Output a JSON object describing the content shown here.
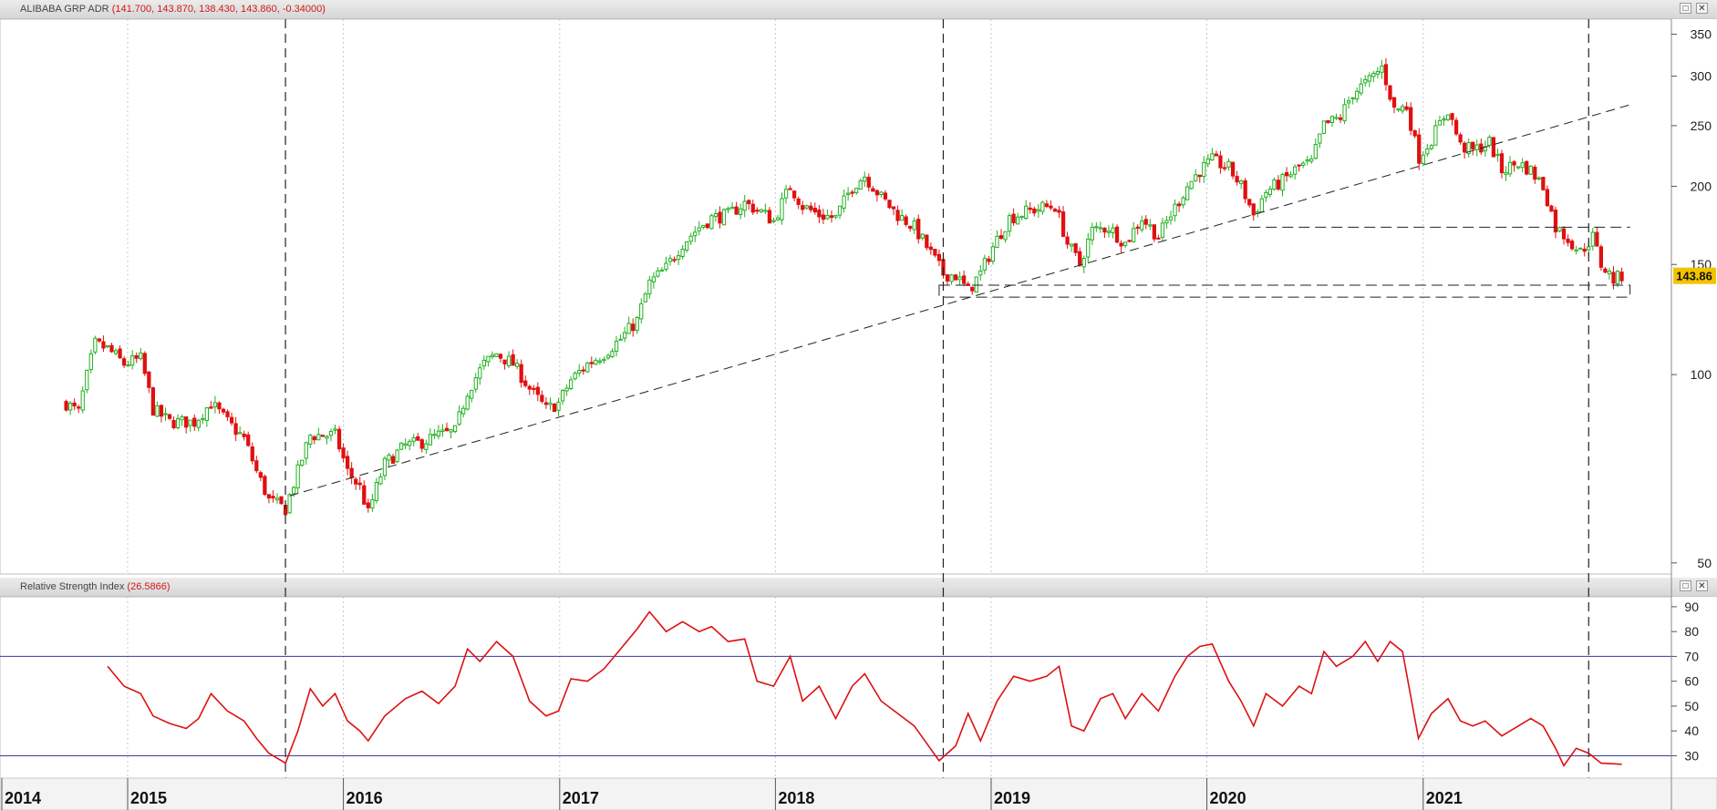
{
  "price_panel": {
    "instrument": "ALIBABA GRP ADR",
    "ohlc_text": "(141.700, 143.870, 138.430, 143.860, -0.34000)",
    "last_price_label": "143.86",
    "y_ticks": [
      {
        "label": "350",
        "value": 350
      },
      {
        "label": "300",
        "value": 300
      },
      {
        "label": "250",
        "value": 250
      },
      {
        "label": "200",
        "value": 200
      },
      {
        "label": "150",
        "value": 150
      },
      {
        "label": "100",
        "value": 100
      },
      {
        "label": "50",
        "value": 50
      }
    ]
  },
  "rsi_panel": {
    "title": "Relative Strength Index",
    "value_text": "(26.5866)",
    "y_ticks": [
      {
        "label": "90",
        "value": 90
      },
      {
        "label": "80",
        "value": 80
      },
      {
        "label": "70",
        "value": 70
      },
      {
        "label": "60",
        "value": 60
      },
      {
        "label": "50",
        "value": 50
      },
      {
        "label": "40",
        "value": 40
      },
      {
        "label": "30",
        "value": 30
      }
    ]
  },
  "colors": {
    "up": "#22b022",
    "down": "#e01010",
    "rsi_line": "#dd1111",
    "rsi_levels": "#3a3aa0",
    "last_badge": "#f2c400"
  },
  "chart_data": [
    {
      "type": "candlestick",
      "title": "ALIBABA GRP ADR",
      "scale": "log",
      "ylim": [
        48,
        370
      ],
      "x_ticks": [
        "2014",
        "2015",
        "2016",
        "2017",
        "2018",
        "2019",
        "2020",
        "2021"
      ],
      "price_path": [
        [
          "2014-09-19",
          90
        ],
        [
          "2014-10-10",
          87
        ],
        [
          "2014-11-07",
          112
        ],
        [
          "2014-11-28",
          110
        ],
        [
          "2014-12-26",
          104
        ],
        [
          "2015-01-23",
          106
        ],
        [
          "2015-02-13",
          88
        ],
        [
          "2015-03-13",
          84
        ],
        [
          "2015-04-24",
          84
        ],
        [
          "2015-05-22",
          90
        ],
        [
          "2015-06-19",
          84
        ],
        [
          "2015-07-17",
          79
        ],
        [
          "2015-08-07",
          70
        ],
        [
          "2015-08-28",
          63
        ],
        [
          "2015-09-25",
          61
        ],
        [
          "2015-10-16",
          70
        ],
        [
          "2015-11-06",
          80
        ],
        [
          "2015-11-27",
          80
        ],
        [
          "2015-12-18",
          80
        ],
        [
          "2016-01-08",
          70
        ],
        [
          "2016-01-29",
          66
        ],
        [
          "2016-02-12",
          60
        ],
        [
          "2016-03-11",
          72
        ],
        [
          "2016-04-15",
          77
        ],
        [
          "2016-05-13",
          78
        ],
        [
          "2016-06-10",
          80
        ],
        [
          "2016-07-08",
          81
        ],
        [
          "2016-07-29",
          94
        ],
        [
          "2016-08-26",
          104
        ],
        [
          "2016-09-16",
          108
        ],
        [
          "2016-10-14",
          104
        ],
        [
          "2016-11-11",
          95
        ],
        [
          "2016-12-09",
          88
        ],
        [
          "2016-12-30",
          90
        ],
        [
          "2017-01-20",
          98
        ],
        [
          "2017-02-17",
          104
        ],
        [
          "2017-03-17",
          108
        ],
        [
          "2017-04-14",
          114
        ],
        [
          "2017-05-12",
          122
        ],
        [
          "2017-06-02",
          140
        ],
        [
          "2017-06-30",
          148
        ],
        [
          "2017-07-28",
          162
        ],
        [
          "2017-08-25",
          172
        ],
        [
          "2017-09-15",
          178
        ],
        [
          "2017-10-13",
          180
        ],
        [
          "2017-11-10",
          188
        ],
        [
          "2017-12-08",
          182
        ],
        [
          "2017-12-29",
          176
        ],
        [
          "2018-01-26",
          200
        ],
        [
          "2018-02-16",
          186
        ],
        [
          "2018-03-16",
          180
        ],
        [
          "2018-04-13",
          178
        ],
        [
          "2018-05-11",
          200
        ],
        [
          "2018-06-01",
          208
        ],
        [
          "2018-06-29",
          192
        ],
        [
          "2018-07-27",
          180
        ],
        [
          "2018-08-24",
          172
        ],
        [
          "2018-09-14",
          160
        ],
        [
          "2018-10-12",
          145
        ],
        [
          "2018-11-02",
          144
        ],
        [
          "2018-11-23",
          136
        ],
        [
          "2018-12-14",
          145
        ],
        [
          "2019-01-04",
          160
        ],
        [
          "2019-02-01",
          178
        ],
        [
          "2019-03-01",
          182
        ],
        [
          "2019-03-29",
          185
        ],
        [
          "2019-04-19",
          186
        ],
        [
          "2019-05-10",
          162
        ],
        [
          "2019-05-31",
          150
        ],
        [
          "2019-06-21",
          170
        ],
        [
          "2019-07-19",
          172
        ],
        [
          "2019-08-16",
          162
        ],
        [
          "2019-09-13",
          178
        ],
        [
          "2019-10-11",
          166
        ],
        [
          "2019-11-08",
          185
        ],
        [
          "2019-11-29",
          200
        ],
        [
          "2019-12-20",
          212
        ],
        [
          "2020-01-10",
          220
        ],
        [
          "2020-02-07",
          214
        ],
        [
          "2020-02-28",
          200
        ],
        [
          "2020-03-20",
          180
        ],
        [
          "2020-04-10",
          196
        ],
        [
          "2020-05-08",
          204
        ],
        [
          "2020-06-05",
          215
        ],
        [
          "2020-06-26",
          218
        ],
        [
          "2020-07-17",
          250
        ],
        [
          "2020-08-14",
          258
        ],
        [
          "2020-09-04",
          282
        ],
        [
          "2020-10-02",
          295
        ],
        [
          "2020-10-23",
          310
        ],
        [
          "2020-11-13",
          265
        ],
        [
          "2020-12-04",
          268
        ],
        [
          "2020-12-24",
          222
        ],
        [
          "2021-01-15",
          238
        ],
        [
          "2021-02-12",
          265
        ],
        [
          "2021-03-05",
          232
        ],
        [
          "2021-03-26",
          228
        ],
        [
          "2021-04-23",
          235
        ],
        [
          "2021-05-14",
          212
        ],
        [
          "2021-06-11",
          218
        ],
        [
          "2021-07-02",
          212
        ],
        [
          "2021-07-23",
          200
        ],
        [
          "2021-08-13",
          172
        ],
        [
          "2021-09-03",
          165
        ],
        [
          "2021-09-24",
          157
        ],
        [
          "2021-10-15",
          166
        ],
        [
          "2021-10-29",
          150
        ],
        [
          "2021-11-19",
          142
        ],
        [
          "2021-12-03",
          143.86
        ]
      ],
      "annotations": {
        "trendline": [
          [
            "2015-10-02",
            64
          ],
          [
            "2021-12-17",
            270
          ]
        ],
        "support_line": [
          [
            "2020-03-13",
            172
          ],
          [
            "2021-12-17",
            172
          ]
        ],
        "support_zone": [
          [
            "2018-10-05",
            133
          ],
          [
            "2021-12-17",
            139
          ]
        ],
        "vertical_markers": [
          "2015-09-25",
          "2018-10-12",
          "2021-10-08"
        ]
      }
    },
    {
      "type": "line",
      "title": "Relative Strength Index",
      "last_value": 26.5866,
      "ylim": [
        21,
        94
      ],
      "levels": [
        30,
        70
      ],
      "x_ticks": [
        "2014",
        "2015",
        "2016",
        "2017",
        "2018",
        "2019",
        "2020",
        "2021"
      ],
      "series": [
        {
          "values": [
            [
              "2014-11-28",
              66
            ],
            [
              "2014-12-26",
              58
            ],
            [
              "2015-01-23",
              55
            ],
            [
              "2015-02-13",
              46
            ],
            [
              "2015-03-13",
              43
            ],
            [
              "2015-04-10",
              41
            ],
            [
              "2015-05-01",
              45
            ],
            [
              "2015-05-22",
              55
            ],
            [
              "2015-06-19",
              48
            ],
            [
              "2015-07-17",
              44
            ],
            [
              "2015-08-07",
              37
            ],
            [
              "2015-08-28",
              31
            ],
            [
              "2015-09-25",
              27
            ],
            [
              "2015-10-16",
              40
            ],
            [
              "2015-11-06",
              57
            ],
            [
              "2015-11-27",
              50
            ],
            [
              "2015-12-18",
              55
            ],
            [
              "2016-01-08",
              44
            ],
            [
              "2016-01-29",
              40
            ],
            [
              "2016-02-12",
              36
            ],
            [
              "2016-03-11",
              46
            ],
            [
              "2016-04-15",
              53
            ],
            [
              "2016-05-13",
              56
            ],
            [
              "2016-06-10",
              51
            ],
            [
              "2016-07-08",
              58
            ],
            [
              "2016-07-29",
              73
            ],
            [
              "2016-08-19",
              68
            ],
            [
              "2016-09-16",
              76
            ],
            [
              "2016-10-14",
              70
            ],
            [
              "2016-11-11",
              52
            ],
            [
              "2016-12-09",
              46
            ],
            [
              "2016-12-30",
              48
            ],
            [
              "2017-01-20",
              61
            ],
            [
              "2017-02-17",
              60
            ],
            [
              "2017-03-17",
              65
            ],
            [
              "2017-04-14",
              73
            ],
            [
              "2017-05-12",
              81
            ],
            [
              "2017-06-02",
              88
            ],
            [
              "2017-06-30",
              80
            ],
            [
              "2017-07-28",
              84
            ],
            [
              "2017-08-25",
              80
            ],
            [
              "2017-09-15",
              82
            ],
            [
              "2017-10-13",
              76
            ],
            [
              "2017-11-10",
              77
            ],
            [
              "2017-12-01",
              60
            ],
            [
              "2017-12-29",
              58
            ],
            [
              "2018-01-26",
              70
            ],
            [
              "2018-02-16",
              52
            ],
            [
              "2018-03-16",
              58
            ],
            [
              "2018-04-13",
              45
            ],
            [
              "2018-05-11",
              58
            ],
            [
              "2018-06-01",
              63
            ],
            [
              "2018-06-29",
              52
            ],
            [
              "2018-07-27",
              47
            ],
            [
              "2018-08-24",
              42
            ],
            [
              "2018-09-14",
              35
            ],
            [
              "2018-10-05",
              28
            ],
            [
              "2018-11-02",
              34
            ],
            [
              "2018-11-23",
              47
            ],
            [
              "2018-12-14",
              36
            ],
            [
              "2019-01-11",
              52
            ],
            [
              "2019-02-08",
              62
            ],
            [
              "2019-03-08",
              60
            ],
            [
              "2019-04-05",
              62
            ],
            [
              "2019-04-26",
              66
            ],
            [
              "2019-05-17",
              42
            ],
            [
              "2019-06-07",
              40
            ],
            [
              "2019-07-05",
              53
            ],
            [
              "2019-07-26",
              55
            ],
            [
              "2019-08-16",
              45
            ],
            [
              "2019-09-13",
              55
            ],
            [
              "2019-10-11",
              48
            ],
            [
              "2019-11-08",
              62
            ],
            [
              "2019-11-29",
              70
            ],
            [
              "2019-12-20",
              74
            ],
            [
              "2020-01-10",
              75
            ],
            [
              "2020-02-07",
              60
            ],
            [
              "2020-02-28",
              52
            ],
            [
              "2020-03-20",
              42
            ],
            [
              "2020-04-10",
              55
            ],
            [
              "2020-05-08",
              50
            ],
            [
              "2020-06-05",
              58
            ],
            [
              "2020-06-26",
              55
            ],
            [
              "2020-07-17",
              72
            ],
            [
              "2020-08-07",
              66
            ],
            [
              "2020-09-04",
              70
            ],
            [
              "2020-09-25",
              76
            ],
            [
              "2020-10-16",
              68
            ],
            [
              "2020-11-06",
              76
            ],
            [
              "2020-11-27",
              72
            ],
            [
              "2020-12-24",
              37
            ],
            [
              "2021-01-15",
              47
            ],
            [
              "2021-02-12",
              53
            ],
            [
              "2021-03-05",
              44
            ],
            [
              "2021-03-26",
              42
            ],
            [
              "2021-04-16",
              44
            ],
            [
              "2021-05-14",
              38
            ],
            [
              "2021-06-11",
              42
            ],
            [
              "2021-07-02",
              45
            ],
            [
              "2021-07-23",
              42
            ],
            [
              "2021-08-13",
              33
            ],
            [
              "2021-08-27",
              26
            ],
            [
              "2021-09-17",
              33
            ],
            [
              "2021-10-08",
              31
            ],
            [
              "2021-10-29",
              27
            ],
            [
              "2021-12-03",
              26.5866
            ]
          ]
        }
      ]
    }
  ]
}
